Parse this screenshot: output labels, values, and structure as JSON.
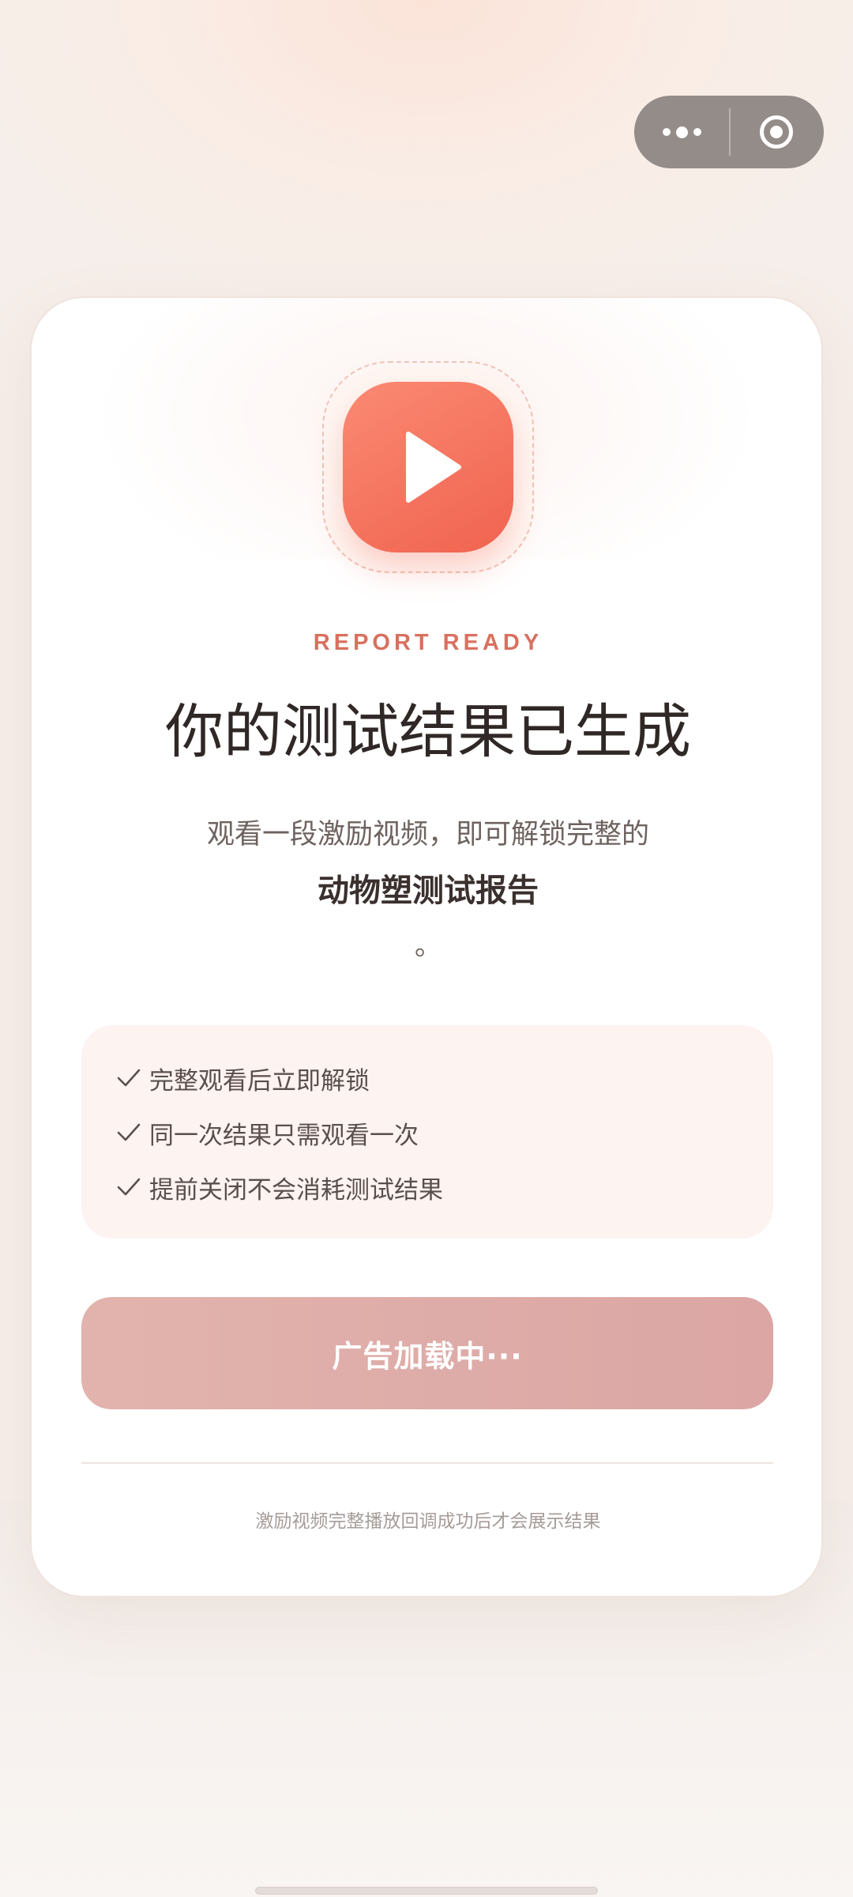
{
  "capsule": {
    "more_icon": "more-dots-icon",
    "close_icon": "target-close-icon"
  },
  "hero": {
    "icon": "play-icon",
    "eyebrow": "REPORT READY",
    "title": "你的测试结果已生成",
    "subtitle": "观看一段激励视频，即可解锁完整的",
    "highlight": "动物塑测试报告",
    "period": "。"
  },
  "features": {
    "icon": "check-icon",
    "items": [
      "完整观看后立即解锁",
      "同一次结果只需观看一次",
      "提前关闭不会消耗测试结果"
    ]
  },
  "action": {
    "button_label": "广告加载中···"
  },
  "footer": {
    "note": "激励视频完整播放回调成功后才会展示结果"
  },
  "colors": {
    "accent": "#f0634f",
    "eyebrow": "#d9705f",
    "button": "#dba6a4"
  }
}
